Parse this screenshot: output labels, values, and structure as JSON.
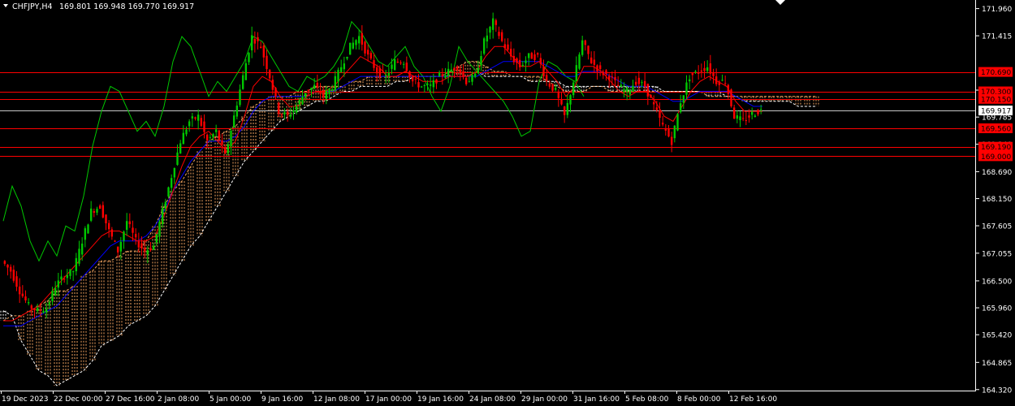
{
  "header": {
    "symbol": "CHFJPY,H4",
    "ohlc": "169.801 169.948 169.770 169.917"
  },
  "colors": {
    "background": "#000000",
    "axis": "#ffffff",
    "bull": "#00c800",
    "bear": "#ff0000",
    "tenkan": "#ff0000",
    "kijun": "#0000ff",
    "chikou": "#00c800",
    "cloud_up": "#f4a460",
    "cloud_down": "#ffffff",
    "level_line": "#ff0000",
    "level_label_bg": "#ff0000",
    "price_label_bg": "#ffffff"
  },
  "chart_data": {
    "type": "line",
    "symbol": "CHFJPY",
    "timeframe": "H4",
    "last_bar": {
      "open": 169.801,
      "high": 169.948,
      "low": 169.77,
      "close": 169.917
    },
    "ylim": [
      164.3,
      172.1
    ],
    "y_ticks": [
      "171.960",
      "171.415",
      "170.325",
      "169.785",
      "169.240",
      "168.690",
      "168.150",
      "167.605",
      "167.055",
      "166.500",
      "165.960",
      "165.420",
      "164.865",
      "164.320"
    ],
    "x_ticks": [
      "19 Dec 2023",
      "22 Dec 00:00",
      "27 Dec 16:00",
      "2 Jan 08:00",
      "5 Jan 00:00",
      "9 Jan 16:00",
      "12 Jan 08:00",
      "17 Jan 00:00",
      "19 Jan 16:00",
      "24 Jan 08:00",
      "29 Jan 00:00",
      "31 Jan 16:00",
      "5 Feb 08:00",
      "8 Feb 00:00",
      "12 Feb 16:00"
    ],
    "horizontal_levels": [
      {
        "value": 170.69,
        "label": "170.690"
      },
      {
        "value": 170.3,
        "label": "170.300"
      },
      {
        "value": 170.15,
        "label": "170.150"
      },
      {
        "value": 169.56,
        "label": "169.560"
      },
      {
        "value": 169.19,
        "label": "169.190"
      },
      {
        "value": 169.0,
        "label": "169.000"
      }
    ],
    "current_price": {
      "value": 169.917,
      "label": "169.917"
    },
    "series": [
      {
        "key": "close",
        "values": [
          166.9,
          166.7,
          166.3,
          166.0,
          165.9,
          165.95,
          166.4,
          166.6,
          166.7,
          167.3,
          167.9,
          168.0,
          167.5,
          167.1,
          167.7,
          167.3,
          167.1,
          167.2,
          167.9,
          168.6,
          169.3,
          169.7,
          169.8,
          169.3,
          169.5,
          169.0,
          169.8,
          170.6,
          171.4,
          171.2,
          170.6,
          169.9,
          169.8,
          170.0,
          170.3,
          170.4,
          170.2,
          170.4,
          170.8,
          171.2,
          171.4,
          171.0,
          170.7,
          170.6,
          170.9,
          170.9,
          170.5,
          170.4,
          170.4,
          170.6,
          170.7,
          170.8,
          170.5,
          170.6,
          171.3,
          171.7,
          171.3,
          171.0,
          170.8,
          171.0,
          171.0,
          170.5,
          170.3,
          169.8,
          170.5,
          171.3,
          170.9,
          170.7,
          170.6,
          170.4,
          170.3,
          170.5,
          170.4,
          170.0,
          169.6,
          169.3,
          170.1,
          170.6,
          170.7,
          170.8,
          170.5,
          170.5,
          169.8,
          169.7,
          169.85,
          169.917
        ]
      },
      {
        "key": "tenkan",
        "values": [
          165.7,
          165.7,
          165.8,
          165.9,
          166.0,
          166.2,
          166.4,
          166.6,
          166.8,
          167.0,
          167.2,
          167.4,
          167.5,
          167.5,
          167.4,
          167.3,
          167.3,
          167.4,
          167.8,
          168.3,
          168.8,
          169.2,
          169.4,
          169.5,
          169.3,
          169.1,
          169.3,
          169.8,
          170.4,
          170.6,
          170.5,
          170.2,
          170.0,
          170.0,
          170.2,
          170.3,
          170.3,
          170.4,
          170.6,
          170.8,
          171.0,
          170.9,
          170.8,
          170.6,
          170.6,
          170.7,
          170.6,
          170.5,
          170.5,
          170.5,
          170.6,
          170.6,
          170.6,
          170.7,
          171.0,
          171.2,
          171.2,
          171.0,
          170.8,
          170.8,
          170.9,
          170.7,
          170.5,
          170.2,
          170.4,
          170.8,
          170.8,
          170.7,
          170.5,
          170.3,
          170.2,
          170.3,
          170.3,
          170.1,
          169.8,
          169.7,
          170.0,
          170.3,
          170.5,
          170.6,
          170.5,
          170.4,
          170.1,
          169.9,
          169.9,
          169.9
        ]
      },
      {
        "key": "kijun",
        "values": [
          165.6,
          165.6,
          165.6,
          165.7,
          165.8,
          165.9,
          166.0,
          166.2,
          166.4,
          166.6,
          166.8,
          167.0,
          167.2,
          167.3,
          167.3,
          167.3,
          167.4,
          167.6,
          167.9,
          168.3,
          168.6,
          168.9,
          169.1,
          169.3,
          169.3,
          169.3,
          169.4,
          169.6,
          169.9,
          170.1,
          170.2,
          170.2,
          170.2,
          170.2,
          170.2,
          170.3,
          170.3,
          170.3,
          170.4,
          170.5,
          170.6,
          170.6,
          170.6,
          170.6,
          170.6,
          170.6,
          170.6,
          170.6,
          170.6,
          170.6,
          170.6,
          170.6,
          170.6,
          170.6,
          170.7,
          170.8,
          170.9,
          170.9,
          170.9,
          170.9,
          170.9,
          170.8,
          170.7,
          170.6,
          170.6,
          170.7,
          170.7,
          170.7,
          170.6,
          170.5,
          170.4,
          170.4,
          170.4,
          170.3,
          170.2,
          170.1,
          170.1,
          170.2,
          170.3,
          170.3,
          170.3,
          170.3,
          170.2,
          170.1,
          170.0,
          170.0
        ]
      },
      {
        "key": "chikou",
        "values": [
          167.7,
          168.4,
          168.0,
          167.3,
          166.9,
          167.3,
          167.0,
          167.6,
          167.5,
          168.2,
          169.2,
          169.9,
          170.4,
          170.3,
          169.9,
          169.5,
          169.7,
          169.4,
          170.0,
          170.9,
          171.4,
          171.2,
          170.7,
          170.2,
          170.5,
          170.3,
          170.6,
          170.9,
          171.4,
          171.3,
          171.0,
          170.7,
          170.4,
          170.3,
          170.6,
          170.5,
          170.6,
          170.8,
          171.1,
          171.7,
          171.5,
          171.2,
          170.9,
          170.8,
          171.0,
          171.2,
          170.8,
          170.6,
          170.2,
          169.9,
          170.4,
          171.2,
          170.9,
          170.7,
          170.5,
          170.3,
          170.1,
          169.8,
          169.4,
          169.5,
          170.5,
          170.9,
          170.8,
          170.6,
          170.5,
          170.2
        ]
      },
      {
        "key": "senkou_a",
        "values": [
          165.7,
          165.8,
          165.8,
          165.9,
          166.0,
          166.1,
          166.3,
          166.3,
          166.4,
          166.6,
          166.7,
          166.9,
          166.9,
          167.0,
          167.1,
          167.1,
          167.3,
          167.6,
          168.0,
          168.3,
          168.5,
          168.8,
          169.1,
          169.3,
          169.4,
          169.5,
          169.6,
          169.8,
          170.0,
          170.1,
          170.2,
          170.2,
          170.2,
          170.3,
          170.3,
          170.4,
          170.4,
          170.4,
          170.4,
          170.5,
          170.5,
          170.6,
          170.6,
          170.6,
          170.6,
          170.6,
          170.6,
          170.6,
          170.6,
          170.6,
          170.7,
          170.8,
          170.9,
          170.9,
          170.8,
          170.7,
          170.7,
          170.6,
          170.6,
          170.6,
          170.6,
          170.5,
          170.4,
          170.3,
          170.3,
          170.3,
          170.4,
          170.4,
          170.3,
          170.3,
          170.3,
          170.3,
          170.3,
          170.3,
          170.3,
          170.3,
          170.3,
          170.3,
          170.3,
          170.2,
          170.2,
          170.2,
          170.2,
          170.2,
          170.2,
          170.2,
          170.2,
          170.2,
          170.2,
          170.2,
          170.2,
          170.2
        ]
      },
      {
        "key": "senkou_b",
        "values": [
          165.9,
          165.8,
          165.3,
          165.0,
          164.7,
          164.6,
          164.4,
          164.5,
          164.6,
          164.7,
          164.9,
          165.2,
          165.3,
          165.4,
          165.6,
          165.7,
          165.8,
          166.0,
          166.3,
          166.6,
          166.9,
          167.2,
          167.4,
          167.7,
          168.0,
          168.3,
          168.6,
          168.9,
          169.1,
          169.3,
          169.5,
          169.7,
          169.8,
          169.9,
          170.0,
          170.1,
          170.1,
          170.2,
          170.3,
          170.3,
          170.4,
          170.4,
          170.4,
          170.4,
          170.5,
          170.5,
          170.6,
          170.6,
          170.6,
          170.6,
          170.6,
          170.6,
          170.6,
          170.7,
          170.6,
          170.6,
          170.6,
          170.6,
          170.6,
          170.5,
          170.5,
          170.5,
          170.5,
          170.4,
          170.4,
          170.4,
          170.4,
          170.4,
          170.4,
          170.4,
          170.4,
          170.4,
          170.4,
          170.4,
          170.3,
          170.3,
          170.3,
          170.3,
          170.3,
          170.3,
          170.3,
          170.2,
          170.2,
          170.1,
          170.1,
          170.1,
          170.1,
          170.1,
          170.1,
          170.0,
          170.0,
          170.0
        ]
      }
    ]
  }
}
